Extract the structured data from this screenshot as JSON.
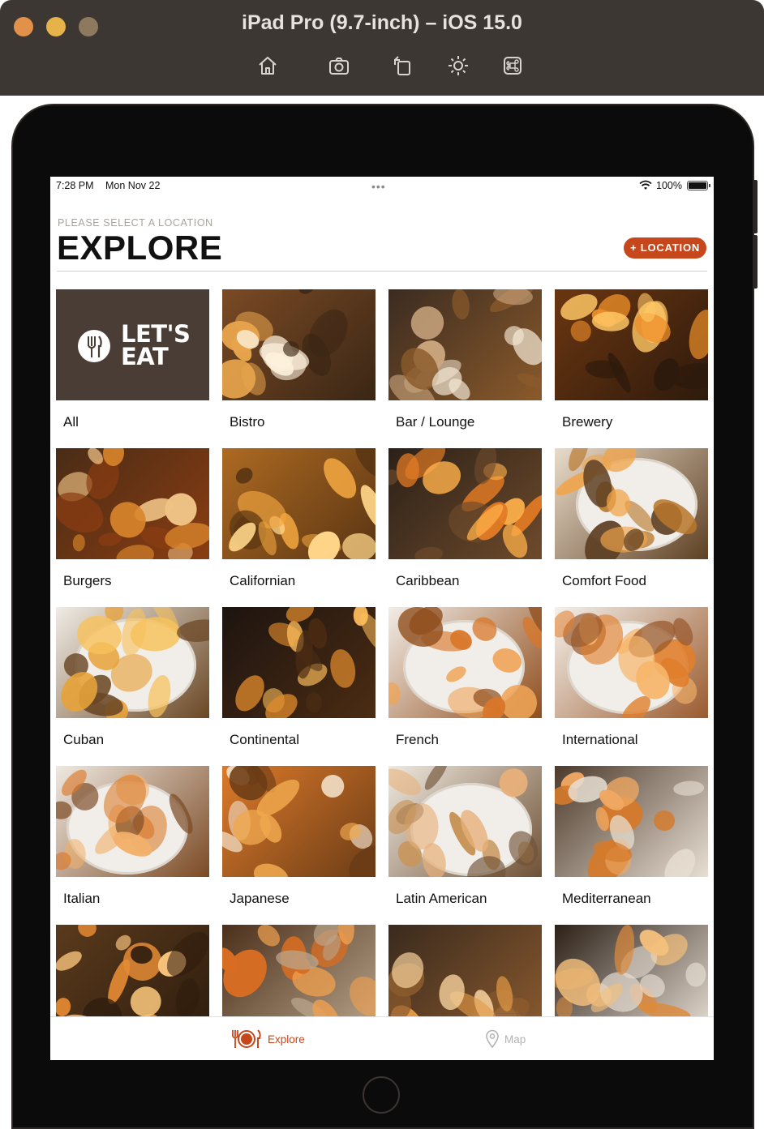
{
  "simulator": {
    "title": "iPad Pro (9.7-inch) – iOS 15.0",
    "toolbar": [
      "home-icon",
      "screenshot-icon",
      "rotate-icon",
      "appearance-icon",
      "command-icon"
    ]
  },
  "status_bar": {
    "time": "7:28 PM",
    "date": "Mon Nov 22",
    "multitask": "•••",
    "battery": "100%"
  },
  "header": {
    "subtitle": "PLEASE SELECT A LOCATION",
    "title": "EXPLORE",
    "location_button": "+ LOCATION"
  },
  "categories": [
    {
      "label": "All",
      "logo": {
        "line1": "LET'S",
        "line2": "EAT"
      }
    },
    {
      "label": "Bistro"
    },
    {
      "label": "Bar / Lounge"
    },
    {
      "label": "Brewery"
    },
    {
      "label": "Burgers"
    },
    {
      "label": "Californian"
    },
    {
      "label": "Caribbean"
    },
    {
      "label": "Comfort Food"
    },
    {
      "label": "Cuban"
    },
    {
      "label": "Continental"
    },
    {
      "label": "French"
    },
    {
      "label": "International"
    },
    {
      "label": "Italian"
    },
    {
      "label": "Japanese"
    },
    {
      "label": "Latin American"
    },
    {
      "label": "Mediterranean"
    },
    {
      "label": ""
    },
    {
      "label": ""
    },
    {
      "label": ""
    },
    {
      "label": ""
    }
  ],
  "tab_bar": {
    "explore": {
      "label": "Explore",
      "icon": "dining-icon",
      "selected": true
    },
    "map": {
      "label": "Map",
      "icon": "map-pin-icon",
      "selected": false
    }
  },
  "colors": {
    "accent": "#c6471c",
    "logo_bg": "#4a3d36",
    "title_bar": "#3d3733"
  }
}
